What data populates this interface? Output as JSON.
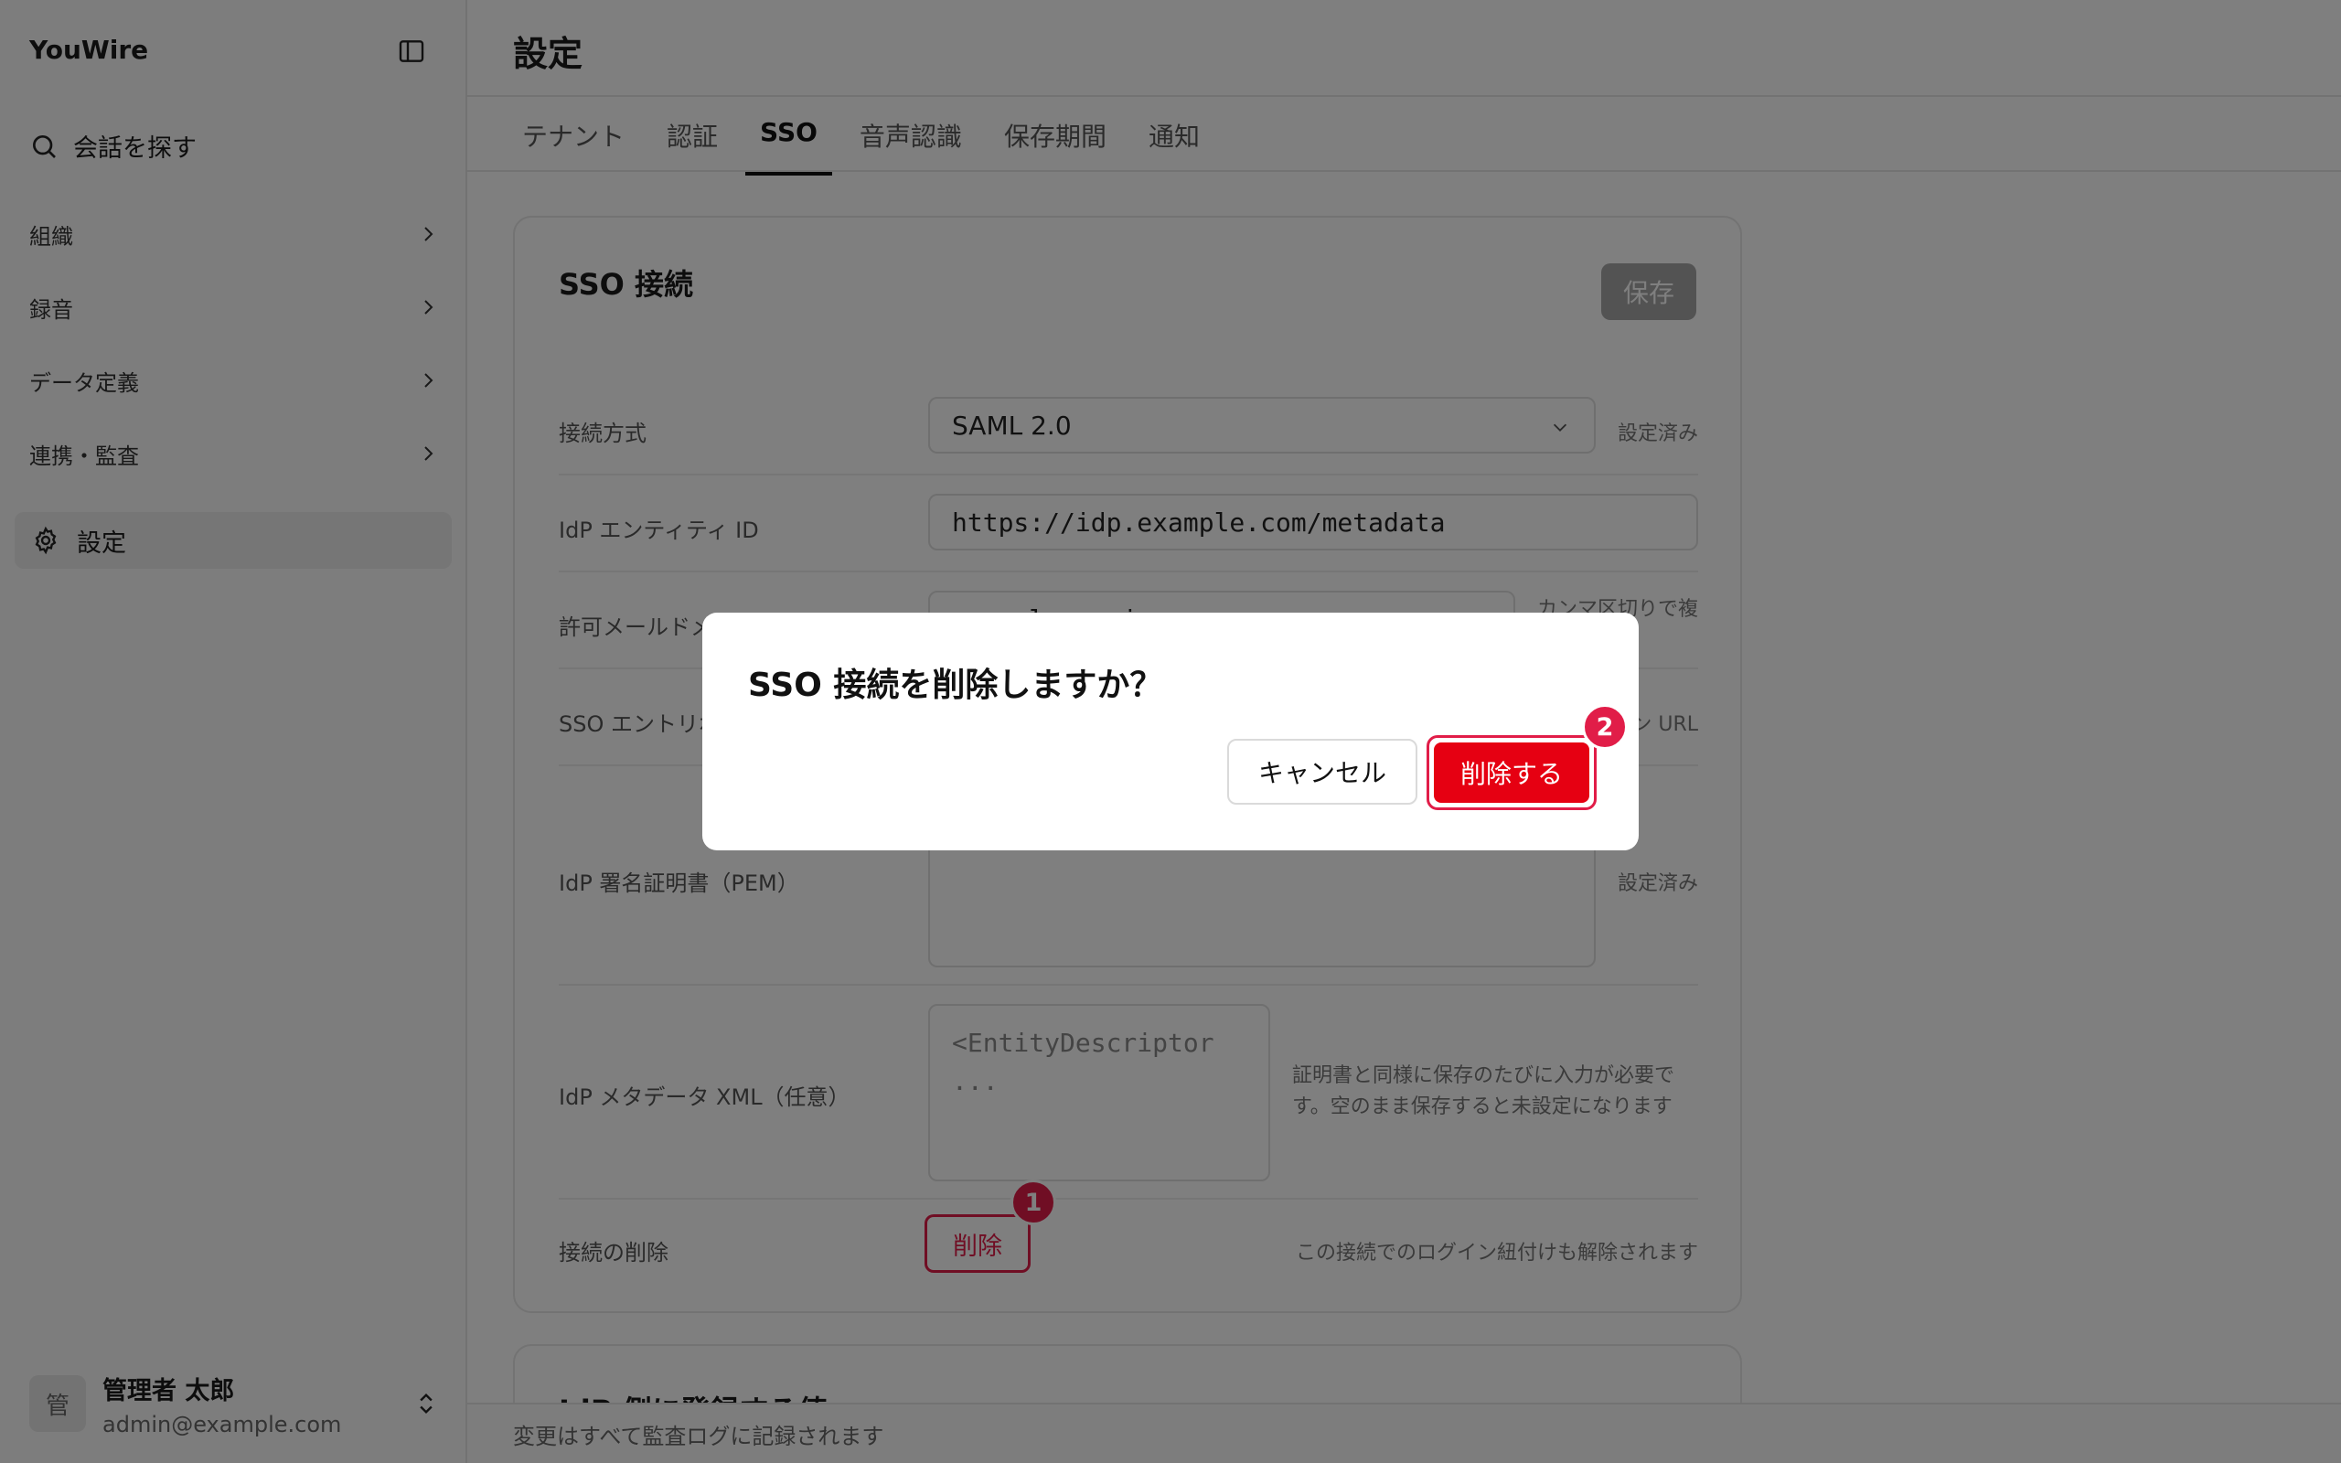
{
  "sidebar": {
    "brand": "YouWire",
    "search_label": "会話を探す",
    "items": [
      {
        "label": "組織"
      },
      {
        "label": "録音"
      },
      {
        "label": "データ定義"
      },
      {
        "label": "連携・監査"
      }
    ],
    "active_item": "設定",
    "user": {
      "avatar": "管",
      "name": "管理者 太郎",
      "email": "admin@example.com"
    }
  },
  "main": {
    "title": "設定",
    "tabs": [
      "テナント",
      "認証",
      "SSO",
      "音声認識",
      "保存期間",
      "通知"
    ],
    "active_tab": "SSO",
    "card": {
      "title": "SSO 接続",
      "save_label": "保存",
      "rows": [
        {
          "label": "接続方式",
          "value": "SAML 2.0",
          "note": "設定済み"
        },
        {
          "label": "IdP エンティティ ID",
          "value": "https://idp.example.com/metadata"
        },
        {
          "label": "許可メールドメイン",
          "value": "example.co.jp",
          "note": "カンマ区切りで複"
        },
        {
          "label": "SSO エントリポ",
          "note": "ン URL"
        },
        {
          "label": "IdP 署名証明書（PEM）",
          "note": "設定済み"
        },
        {
          "label": "IdP メタデータ XML（任意）",
          "value_line1": "<EntityDescriptor",
          "value_line2": "...",
          "note_line1": "証明書と同様に保存のたびに入力が必要で",
          "note_line2": "す。空のまま保存すると未設定になります"
        },
        {
          "label": "接続の削除",
          "button": "削除",
          "note": "この接続でのログイン紐付けも解除されます"
        }
      ]
    },
    "card2_title": "IdP 側に登録する値",
    "footer": "変更はすべて監査ログに記録されます"
  },
  "dialog": {
    "title": "SSO 接続を削除しますか？",
    "cancel": "キャンセル",
    "confirm": "削除する"
  },
  "badges": [
    "1",
    "2"
  ],
  "colors": {
    "accent_red": "#e60012",
    "badge": "#e11d48"
  }
}
